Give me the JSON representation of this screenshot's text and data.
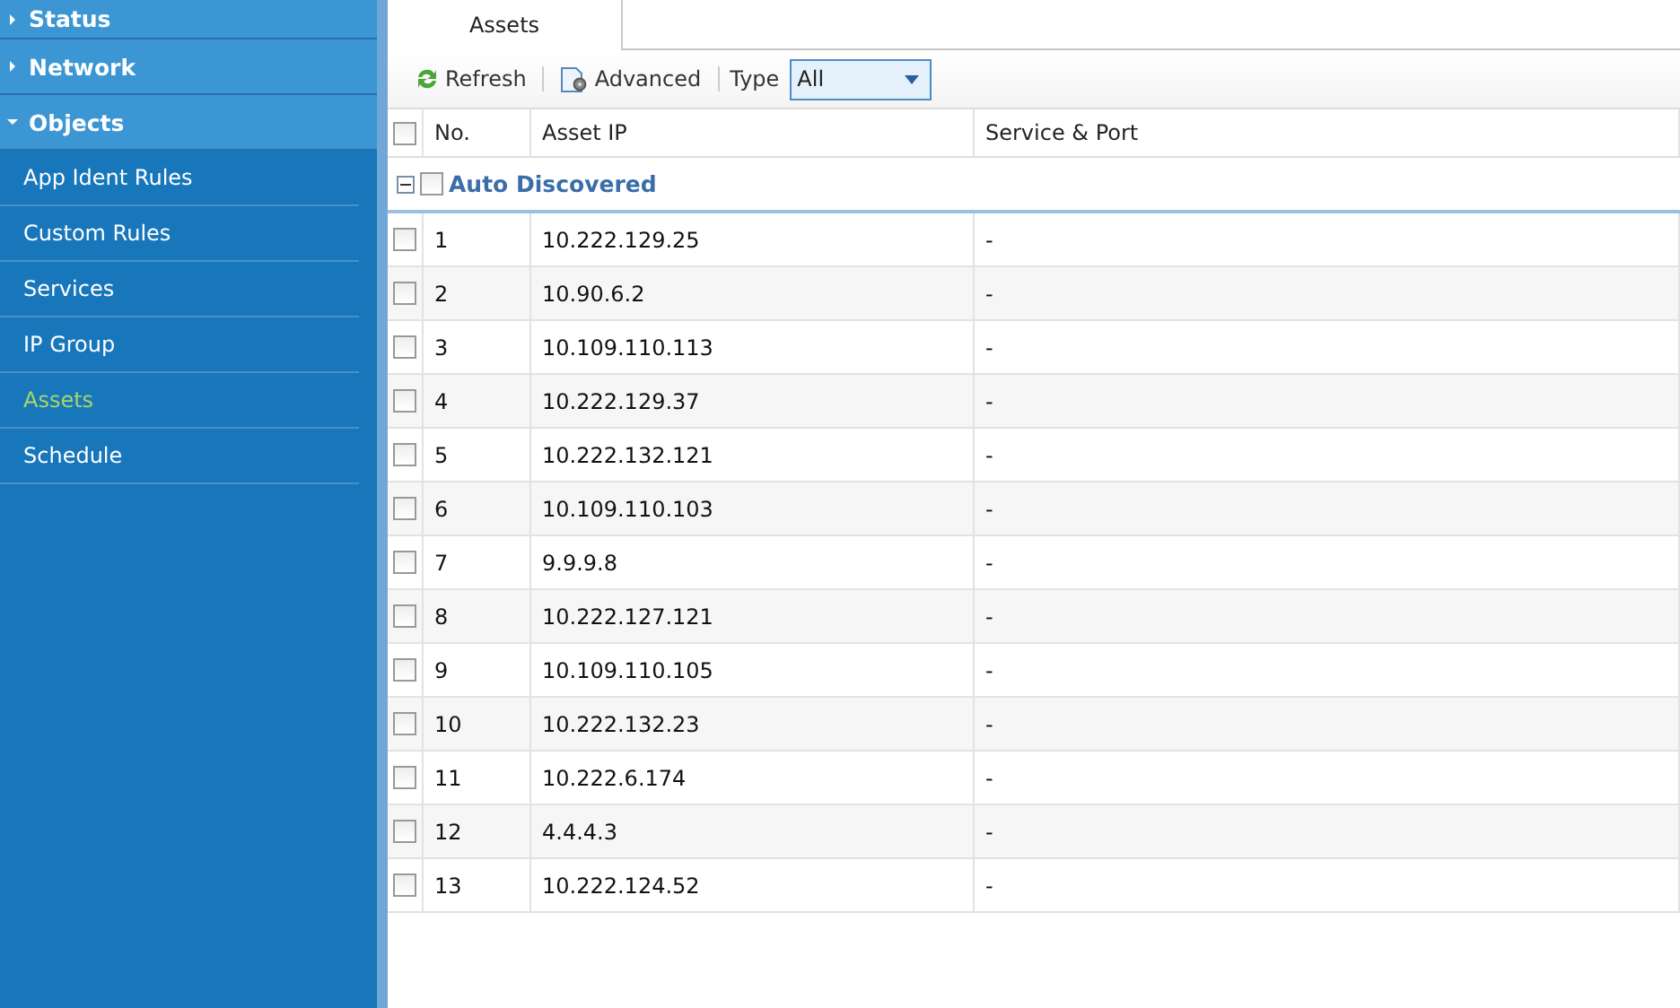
{
  "sidebar": {
    "groups": [
      {
        "label": "Status",
        "expanded": false
      },
      {
        "label": "Network",
        "expanded": false
      },
      {
        "label": "Objects",
        "expanded": true,
        "children": [
          {
            "label": "App Ident Rules",
            "selected": false
          },
          {
            "label": "Custom Rules",
            "selected": false
          },
          {
            "label": "Services",
            "selected": false
          },
          {
            "label": "IP Group",
            "selected": false
          },
          {
            "label": "Assets",
            "selected": true
          },
          {
            "label": "Schedule",
            "selected": false
          }
        ]
      }
    ]
  },
  "tabs": [
    {
      "label": "Assets",
      "selected": true
    }
  ],
  "toolbar": {
    "refresh": "Refresh",
    "advanced": "Advanced",
    "type_label": "Type",
    "type_value": "All"
  },
  "table": {
    "columns": [
      "No.",
      "Asset IP",
      "Service & Port"
    ],
    "select_all": false,
    "group": {
      "label": "Auto Discovered",
      "expanded": true,
      "checked": false
    },
    "rows": [
      {
        "no": "1",
        "ip": "10.222.129.25",
        "service": "-",
        "checked": false
      },
      {
        "no": "2",
        "ip": "10.90.6.2",
        "service": "-",
        "checked": false
      },
      {
        "no": "3",
        "ip": "10.109.110.113",
        "service": "-",
        "checked": false
      },
      {
        "no": "4",
        "ip": "10.222.129.37",
        "service": "-",
        "checked": false
      },
      {
        "no": "5",
        "ip": "10.222.132.121",
        "service": "-",
        "checked": false
      },
      {
        "no": "6",
        "ip": "10.109.110.103",
        "service": "-",
        "checked": false
      },
      {
        "no": "7",
        "ip": "9.9.9.8",
        "service": "-",
        "checked": false
      },
      {
        "no": "8",
        "ip": "10.222.127.121",
        "service": "-",
        "checked": false
      },
      {
        "no": "9",
        "ip": "10.109.110.105",
        "service": "-",
        "checked": false
      },
      {
        "no": "10",
        "ip": "10.222.132.23",
        "service": "-",
        "checked": false
      },
      {
        "no": "11",
        "ip": "10.222.6.174",
        "service": "-",
        "checked": false
      },
      {
        "no": "12",
        "ip": "4.4.4.3",
        "service": "-",
        "checked": false
      },
      {
        "no": "13",
        "ip": "10.222.124.52",
        "service": "-",
        "checked": false
      }
    ]
  }
}
